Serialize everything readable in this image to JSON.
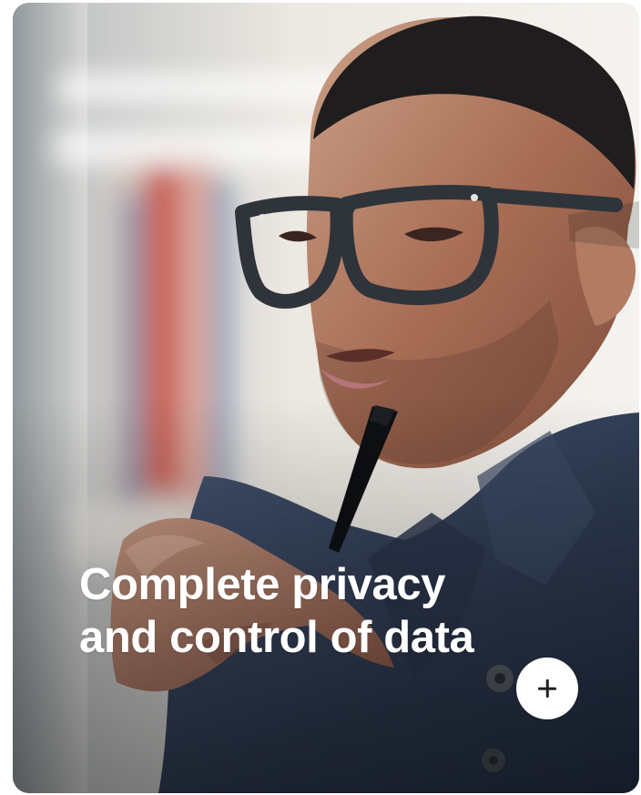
{
  "card": {
    "title": "Complete privacy and control of data"
  },
  "actions": {
    "plus_icon": "plus-icon"
  },
  "colors": {
    "card_text": "#ffffff",
    "button_background": "#ffffff",
    "icon": "#1f1f1f"
  }
}
